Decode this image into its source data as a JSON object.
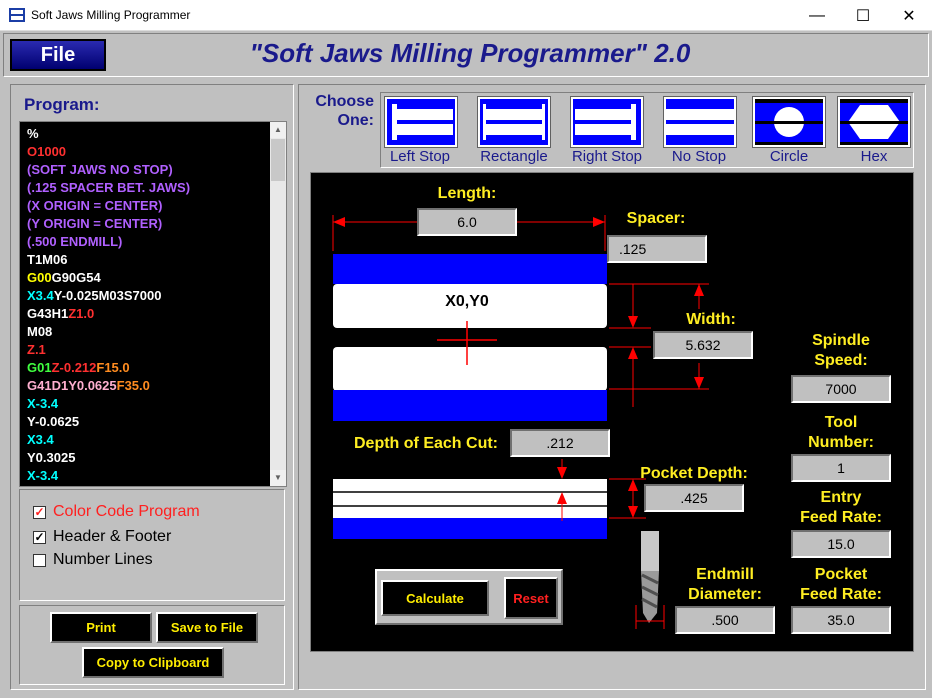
{
  "window": {
    "title": "Soft Jaws Milling Programmer",
    "minimize": "—",
    "maximize": "☐",
    "close": "✕"
  },
  "header": {
    "file_label": "File",
    "app_title": "\"Soft Jaws Milling Programmer\" 2.0"
  },
  "program": {
    "label": "Program:",
    "lines": [
      [
        {
          "t": "%",
          "c": "#ffffff"
        }
      ],
      [
        {
          "t": "O1000",
          "c": "#ff3030"
        }
      ],
      [
        {
          "t": "(SOFT JAWS NO STOP)",
          "c": "#b060ff"
        }
      ],
      [
        {
          "t": "(.125 SPACER BET. JAWS)",
          "c": "#b060ff"
        }
      ],
      [
        {
          "t": "(X ORIGIN = CENTER)",
          "c": "#b060ff"
        }
      ],
      [
        {
          "t": "(Y ORIGIN = CENTER)",
          "c": "#b060ff"
        }
      ],
      [
        {
          "t": "(.500 ENDMILL)",
          "c": "#b060ff"
        }
      ],
      [
        {
          "t": "T1M06",
          "c": "#ffffff"
        }
      ],
      [
        {
          "t": "G00",
          "c": "#ffff00"
        },
        {
          "t": "G90G54",
          "c": "#ffffff"
        }
      ],
      [
        {
          "t": "X3.4",
          "c": "#00ffff"
        },
        {
          "t": "Y-0.025M03S7000",
          "c": "#ffffff"
        }
      ],
      [
        {
          "t": "G43H1",
          "c": "#ffffff"
        },
        {
          "t": "Z1.0",
          "c": "#ff3030"
        }
      ],
      [
        {
          "t": "M08",
          "c": "#ffffff"
        }
      ],
      [
        {
          "t": "Z.1",
          "c": "#ff3030"
        }
      ],
      [
        {
          "t": "G01",
          "c": "#40ff40"
        },
        {
          "t": "Z-0.212",
          "c": "#ff3030"
        },
        {
          "t": "F15.0",
          "c": "#ff8c20"
        }
      ],
      [
        {
          "t": "G41D1Y0.0625",
          "c": "#ffb0d0"
        },
        {
          "t": "F35.0",
          "c": "#ff8c20"
        }
      ],
      [
        {
          "t": "X-3.4",
          "c": "#00ffff"
        }
      ],
      [
        {
          "t": "Y-0.0625",
          "c": "#ffffff"
        }
      ],
      [
        {
          "t": "X3.4",
          "c": "#00ffff"
        }
      ],
      [
        {
          "t": "Y0.3025",
          "c": "#ffffff"
        }
      ],
      [
        {
          "t": "X-3.4",
          "c": "#00ffff"
        }
      ]
    ]
  },
  "options": {
    "color_code": {
      "label": "Color Code Program",
      "checked": true
    },
    "header_footer": {
      "label": "Header & Footer",
      "checked": true
    },
    "number_lines": {
      "label": "Number Lines",
      "checked": false
    }
  },
  "actions": {
    "print": "Print",
    "save": "Save to File",
    "copy": "Copy to Clipboard"
  },
  "shapes": {
    "choose_line1": "Choose",
    "choose_line2": "One:",
    "items": [
      "Left Stop",
      "Rectangle",
      "Right Stop",
      "No Stop",
      "Circle",
      "Hex"
    ]
  },
  "params": {
    "length": {
      "label": "Length:",
      "value": "6.0"
    },
    "spacer": {
      "label": "Spacer:",
      "value": ".125"
    },
    "origin": "X0,Y0",
    "width": {
      "label": "Width:",
      "value": "5.632"
    },
    "spindle": {
      "label1": "Spindle",
      "label2": "Speed:",
      "value": "7000"
    },
    "tool": {
      "label1": "Tool",
      "label2": "Number:",
      "value": "1"
    },
    "depth_cut": {
      "label": "Depth of Each Cut:",
      "value": ".212"
    },
    "pocket_depth": {
      "label": "Pocket Depth:",
      "value": ".425"
    },
    "entry_feed": {
      "label1": "Entry",
      "label2": "Feed Rate:",
      "value": "15.0"
    },
    "endmill": {
      "label1": "Endmill",
      "label2": "Diameter:",
      "value": ".500"
    },
    "pocket_feed": {
      "label1": "Pocket",
      "label2": "Feed Rate:",
      "value": "35.0"
    },
    "calculate": "Calculate",
    "reset": "Reset"
  }
}
